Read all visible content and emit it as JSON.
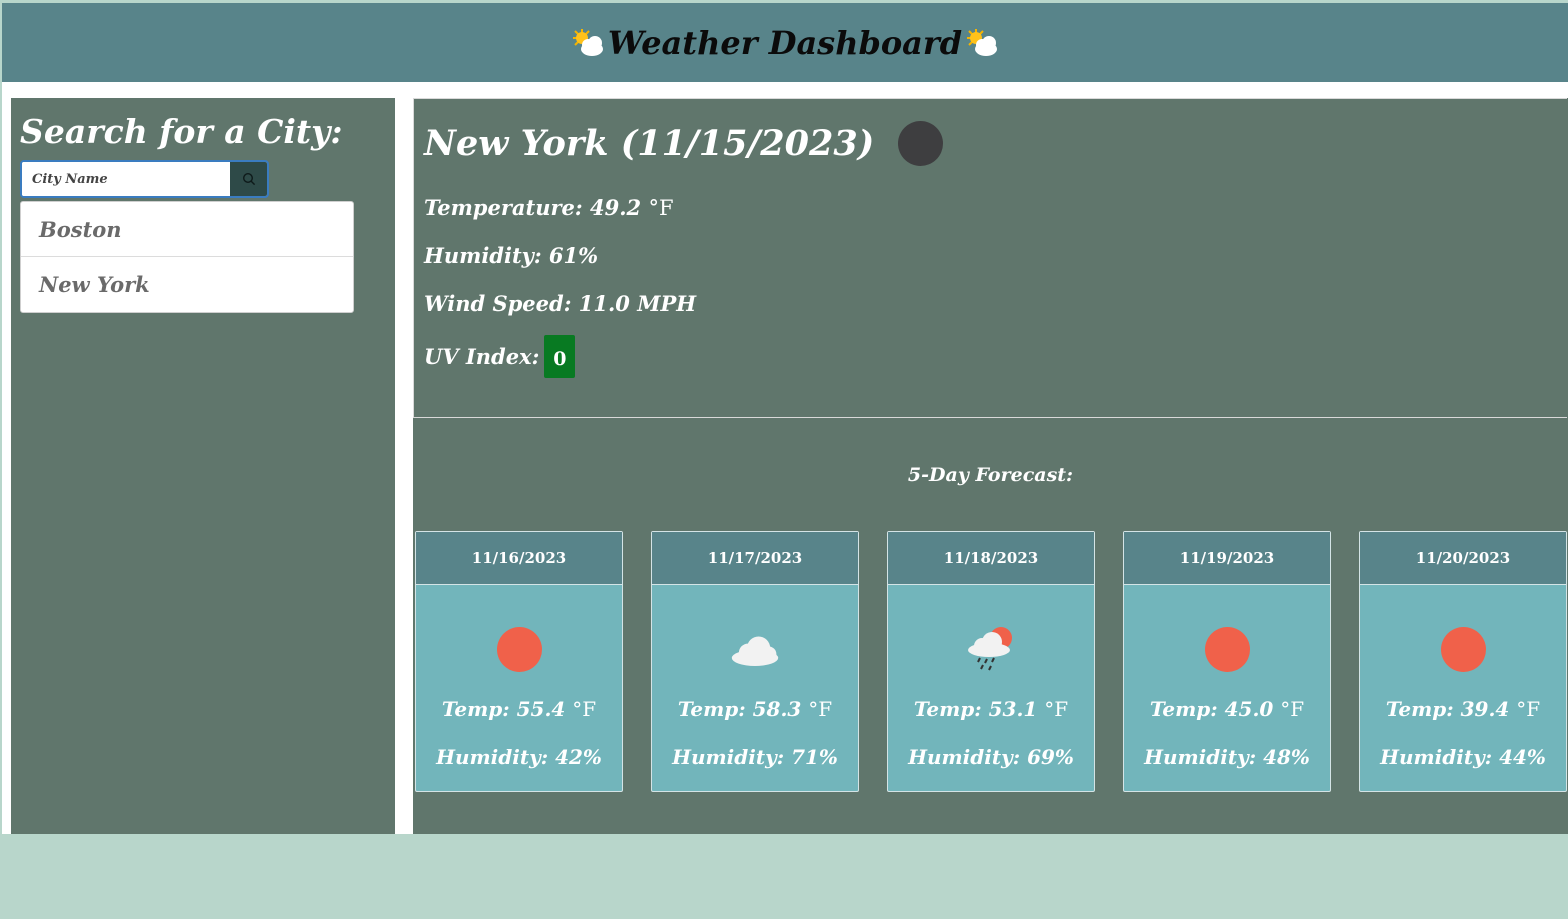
{
  "header": {
    "title": "Weather Dashboard",
    "icon": "sun-behind-cloud-icon"
  },
  "sidebar": {
    "search_title": "Search for a City:",
    "search": {
      "placeholder": "City Name",
      "value": ""
    },
    "history": [
      "Boston",
      "New York"
    ]
  },
  "current": {
    "title": "New York (11/15/2023)",
    "icon": "clear-night-icon",
    "temperature_label": "Temperature: 49.2",
    "humidity": "Humidity: 61%",
    "wind": "Wind Speed: 11.0 MPH",
    "uv_label": "UV Index:",
    "uv_value": "0",
    "uv_color": "#087a22"
  },
  "forecast": {
    "title": "5-Day Forecast:",
    "unit": "°F",
    "days": [
      {
        "date": "11/16/2023",
        "icon": "clear-sun-icon",
        "temp": "Temp: 55.4",
        "humidity": "Humidity: 42%"
      },
      {
        "date": "11/17/2023",
        "icon": "cloud-icon",
        "temp": "Temp: 58.3",
        "humidity": "Humidity: 71%"
      },
      {
        "date": "11/18/2023",
        "icon": "rain-cloud-sun-icon",
        "temp": "Temp: 53.1",
        "humidity": "Humidity: 69%"
      },
      {
        "date": "11/19/2023",
        "icon": "clear-sun-icon",
        "temp": "Temp: 45.0",
        "humidity": "Humidity: 48%"
      },
      {
        "date": "11/20/2023",
        "icon": "clear-sun-icon",
        "temp": "Temp: 39.4",
        "humidity": "Humidity: 44%"
      }
    ]
  },
  "colors": {
    "header": "#58848a",
    "panel": "#60766c",
    "card": "#72b5bb",
    "sun": "#f0614a",
    "background": "#b8d6cb"
  }
}
